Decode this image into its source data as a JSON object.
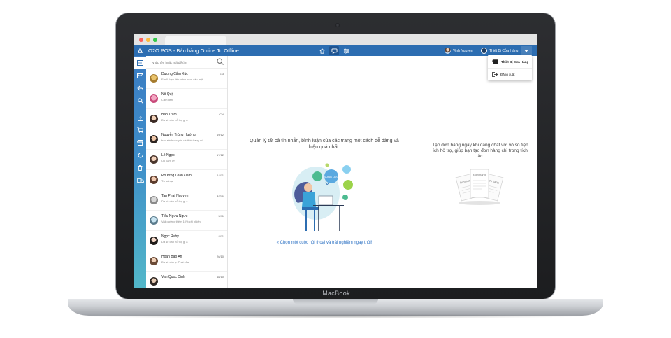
{
  "device": {
    "brand_label": "MacBook"
  },
  "app": {
    "title": "O2O POS - Bán hàng Online To Offline",
    "accent": "#2c6db1"
  },
  "header": {
    "nav_icons": [
      "home-icon",
      "chat-icon",
      "settings-icon"
    ],
    "user_name": "Vinh Nguyen",
    "store_name": "Thiết Bị Cửa Hàng"
  },
  "menu": {
    "items": [
      {
        "label": "Thiết Bị Cửa Hàng",
        "icon": "store-icon"
      },
      {
        "label": "Đăng xuất",
        "icon": "logout-icon"
      }
    ]
  },
  "search": {
    "placeholder": "Nhập tên hoặc mã để tìm"
  },
  "conversations": [
    {
      "name": "Dương Cẩm Xúc",
      "preview": "Em lỗ bạn liên minh mua cấp một",
      "date": "7/3"
    },
    {
      "name": "Nỗ Quịt",
      "preview": "Cảm tiền",
      "date": ""
    },
    {
      "name": "Bao Tram",
      "preview": "Da sẽ cần hỗ trợ gì ạ",
      "date": "CN"
    },
    {
      "name": "Nguyễn Trùng Hướng",
      "preview": "bán sách chuyên về thời trang dùi",
      "date": "19/12"
    },
    {
      "name": "Lê Ngọc",
      "preview": "Ok cảm ơn",
      "date": "17/12"
    },
    {
      "name": "Phương Loan Đàm",
      "preview": "Tư vấn ạ",
      "date": "14/11"
    },
    {
      "name": "Tan Phat Nguyen",
      "preview": "Da sẽ cần hỗ trợ gì ạ",
      "date": "12/11"
    },
    {
      "name": "Tiểu Ngưu Ngưu",
      "preview": "Vali dưỡng thêm 10% chi nhiên",
      "date": "5/11"
    },
    {
      "name": "Ngọc Ruby",
      "preview": "Da sẽ cần hỗ trợ gì ạ",
      "date": "8/11"
    },
    {
      "name": "Hoàn Bảo An",
      "preview": "Da sẽ cần ạ. Phải của",
      "date": "26/10"
    },
    {
      "name": "Van Quoc Dinh",
      "preview": "",
      "date": "18/10"
    }
  ],
  "main": {
    "message": "Quản lý tất cả tin nhắn, bình luận của các trang một cách dễ dàng và hiệu quả nhất.",
    "link": "« Chọn một cuộc hội thoại và trải nghiệm ngay thôi!",
    "illustration_label": "SUNG O2O"
  },
  "right": {
    "message": "Tạo đơn hàng ngay khi đang chat với vô số tiện ích hỗ trợ, giúp bạn tạo đơn hàng chỉ trong tích tắc.",
    "illustration_label_1": "Đơn hàng",
    "illustration_label_2": "Đơn hàng",
    "illustration_label_3": "Đơn hàng"
  },
  "rail_icons": [
    "list-icon",
    "mail-icon",
    "reply-icon",
    "search-icon",
    "help-icon",
    "cart-icon",
    "store-icon",
    "refresh-icon",
    "trash-icon",
    "truck-icon"
  ]
}
